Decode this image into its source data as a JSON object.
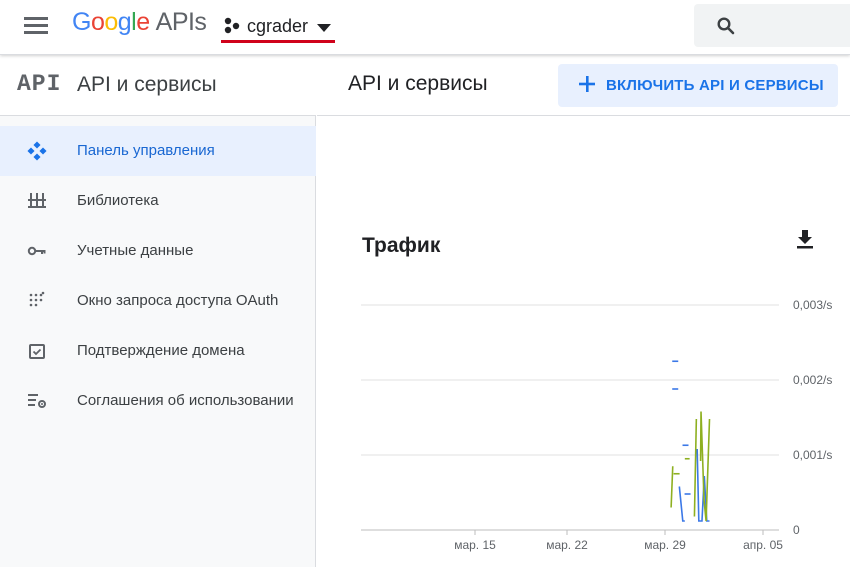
{
  "topbar": {
    "logo_google": [
      "G",
      "o",
      "o",
      "g",
      "l",
      "e"
    ],
    "logo_suffix": "APIs",
    "project_name": "cgrader",
    "search_icon": "search-icon",
    "menu_icon": "hamburger-menu-icon"
  },
  "sidebar": {
    "mark": "API",
    "title": "API и сервисы",
    "items": [
      {
        "label": "Панель управления",
        "icon": "dashboard-icon",
        "active": true
      },
      {
        "label": "Библиотека",
        "icon": "library-icon",
        "active": false
      },
      {
        "label": "Учетные данные",
        "icon": "key-icon",
        "active": false
      },
      {
        "label": "Окно запроса доступа OAuth",
        "icon": "oauth-consent-icon",
        "active": false
      },
      {
        "label": "Подтверждение домена",
        "icon": "domain-verification-icon",
        "active": false
      },
      {
        "label": "Соглашения об использовании",
        "icon": "agreements-icon",
        "active": false
      }
    ]
  },
  "main": {
    "title": "API и сервисы",
    "enable_button": "ВКЛЮЧИТЬ API И СЕРВИСЫ",
    "card_title": "Трафик"
  },
  "colors": {
    "accent": "#1a73e8",
    "series_blue": "#3b78e7",
    "series_olive": "#8eb021",
    "grid": "#e0e0e0"
  },
  "chart_data": {
    "type": "line",
    "title": "Трафик",
    "x_ticks": [
      "мар. 15",
      "мар. 22",
      "мар. 29",
      "апр. 05"
    ],
    "y_ticks": [
      "0",
      "0,001/s",
      "0,002/s",
      "0,003/s"
    ],
    "ylim": [
      0,
      0.003
    ],
    "grid": true,
    "series": [
      {
        "color": "#3b78e7",
        "segments": [
          [
            [
              14.6,
              0.00225
            ]
          ],
          [
            [
              14.6,
              0.00188
            ]
          ],
          [
            [
              15.35,
              0.00113
            ]
          ],
          [
            [
              15.5,
              0.00048
            ]
          ],
          [
            [
              14.9,
              0.00058
            ],
            [
              15.15,
              0.00012
            ],
            [
              15.3,
              0.00012
            ]
          ],
          [
            [
              16.2,
              0.00108
            ],
            [
              16.32,
              0.00012
            ],
            [
              16.55,
              0.00012
            ],
            [
              16.72,
              0.00072
            ],
            [
              16.9,
              0.00012
            ],
            [
              17.1,
              0.00012
            ]
          ]
        ]
      },
      {
        "color": "#8eb021",
        "segments": [
          [
            [
              14.7,
              0.00075
            ]
          ],
          [
            [
              15.3,
              0.00095
            ],
            [
              15.65,
              0.00095
            ]
          ],
          [
            [
              14.3,
              0.0003
            ],
            [
              14.42,
              0.00085
            ]
          ],
          [
            [
              16.0,
              0.00018
            ],
            [
              16.14,
              0.00148
            ]
          ],
          [
            [
              16.45,
              0.00092
            ],
            [
              16.48,
              0.00158
            ],
            [
              16.7,
              0.0004
            ],
            [
              16.85,
              0.00012
            ],
            [
              17.1,
              0.00148
            ]
          ]
        ]
      }
    ]
  }
}
